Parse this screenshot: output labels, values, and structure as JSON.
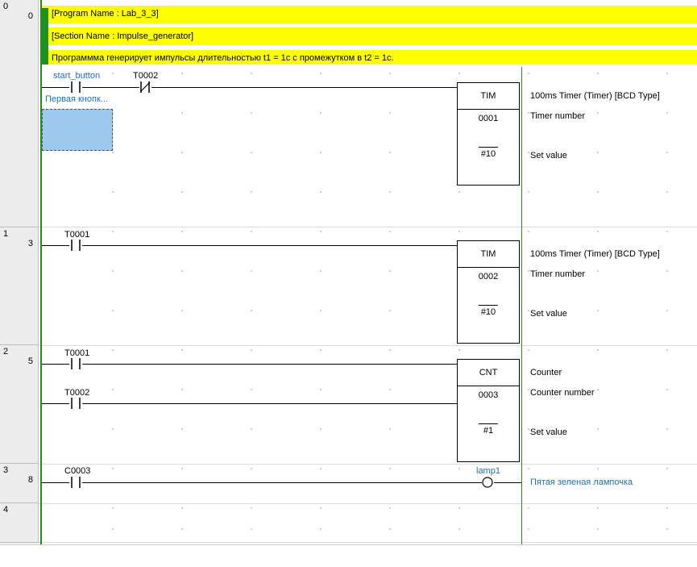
{
  "header": {
    "program_name": "[Program Name : Lab_3_3]",
    "section_name": "[Section Name : Impulse_generator]",
    "description": "Программма генерирует импульсы длительностью t1 = 1c с промежутком в t2 = 1c."
  },
  "rungs": [
    {
      "index": "0",
      "step": "0"
    },
    {
      "index": "1",
      "step": "3"
    },
    {
      "index": "2",
      "step": "5"
    },
    {
      "index": "3",
      "step": "8"
    },
    {
      "index": "4",
      "step": ""
    }
  ],
  "rung0": {
    "contact1_label": "start_button",
    "contact1_comment": "Первая кнопк...",
    "contact2_label": "T0002",
    "instr": "TIM",
    "number": "0001",
    "set_value": "#10",
    "desc_instr": "100ms Timer (Timer) [BCD Type]",
    "desc_number": "Timer number",
    "desc_set": "Set value"
  },
  "rung1": {
    "contact1_label": "T0001",
    "instr": "TIM",
    "number": "0002",
    "set_value": "#10",
    "desc_instr": "100ms Timer (Timer) [BCD Type]",
    "desc_number": "Timer number",
    "desc_set": "Set value"
  },
  "rung2": {
    "contact1_label": "T0001",
    "contact2_label": "T0002",
    "instr": "CNT",
    "number": "0003",
    "set_value": "#1",
    "desc_instr": "Counter",
    "desc_number": "Counter number",
    "desc_set": "Set value"
  },
  "rung3": {
    "contact1_label": "C0003",
    "coil_label": "lamp1",
    "coil_comment": "Пятая зеленая лампочка"
  },
  "colors": {
    "rail": "#1f8f1f",
    "comment_bg": "#ffff00",
    "symbol_blue": "#1f6fbf",
    "selection": "#9ec9ef"
  }
}
